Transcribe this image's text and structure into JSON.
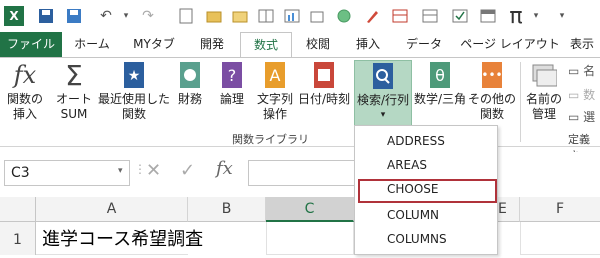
{
  "quick_access": {
    "icons": [
      "excel-icon",
      "save-icon",
      "undo-icon",
      "redo-icon",
      "new-icon",
      "open-icon",
      "folder-icon",
      "pane-icon",
      "graph-icon",
      "circle-icon",
      "brush-icon",
      "table-icon",
      "check-icon",
      "pi-icon",
      "more-icon"
    ],
    "pi": "π"
  },
  "tabs": [
    "ファイル",
    "ホーム",
    "MYタブ",
    "開発",
    "数式",
    "校閲",
    "挿入",
    "データ",
    "ページ レイアウト",
    "表示"
  ],
  "ribbon": {
    "buttons": [
      {
        "label": "関数の\n挿入",
        "icon": "fx"
      },
      {
        "label": "オート\nSUM",
        "icon": "Σ"
      },
      {
        "label": "最近使用した\n関数",
        "icon": "★"
      },
      {
        "label": "財務",
        "icon": "$"
      },
      {
        "label": "論理",
        "icon": "?"
      },
      {
        "label": "文字列\n操作",
        "icon": "A"
      },
      {
        "label": "日付/時刻",
        "icon": "date"
      },
      {
        "label": "検索/行列",
        "icon": "search"
      },
      {
        "label": "数学/三角",
        "icon": "θ"
      },
      {
        "label": "その他の\n関数",
        "icon": "more"
      },
      {
        "label": "名前の\n管理",
        "icon": "names"
      }
    ],
    "side_labels": [
      "名",
      "数",
      "選"
    ],
    "group_library": "関数ライブラリ",
    "group_defined": "定義さ"
  },
  "formula_bar": {
    "name_box": "C3",
    "fx": "fx"
  },
  "columns": [
    "A",
    "B",
    "C",
    "E",
    "F"
  ],
  "rows": [
    "1"
  ],
  "cell_a1": "進学コース希望調査",
  "dropdown": {
    "items": [
      "ADDRESS",
      "AREAS",
      "CHOOSE",
      "COLUMN",
      "COLUMNS"
    ],
    "highlighted": "CHOOSE"
  }
}
